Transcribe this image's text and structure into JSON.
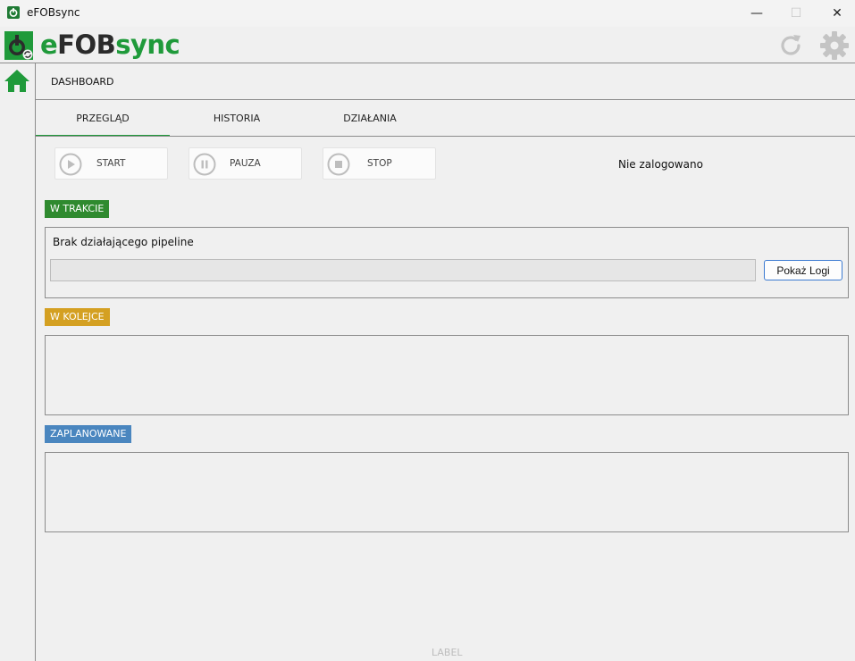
{
  "window": {
    "title": "eFOBsync",
    "min_glyph": "—",
    "max_glyph": "☐",
    "close_glyph": "✕"
  },
  "header": {
    "logo_part_e": "e",
    "logo_part_fob": "FOB",
    "logo_part_sync": "sync",
    "refresh_icon": "refresh-icon",
    "settings_icon": "gear-icon"
  },
  "sidebar": {
    "items": [
      {
        "icon": "home-icon"
      }
    ]
  },
  "breadcrumb": "DASHBOARD",
  "tabs": [
    {
      "label": "PRZEGLĄD",
      "active": true
    },
    {
      "label": "HISTORIA",
      "active": false
    },
    {
      "label": "DZIAŁANIA",
      "active": false
    }
  ],
  "controls": {
    "start_label": "START",
    "pause_label": "PAUZA",
    "stop_label": "STOP"
  },
  "status_text": "Nie zalogowano",
  "sections": {
    "in_progress": {
      "badge": "W TRAKCIE",
      "color": "#2f8a2f",
      "message": "Brak działającego pipeline",
      "progress": 0,
      "logs_button": "Pokaż Logi"
    },
    "queue": {
      "badge": "W KOLEJCE",
      "color": "#d4a022"
    },
    "scheduled": {
      "badge": "ZAPLANOWANE",
      "color": "#4a86bf"
    }
  },
  "footer_label": "LABEL",
  "colors": {
    "brand_green": "#1f9a3a",
    "brand_dark": "#2b2b2b"
  }
}
